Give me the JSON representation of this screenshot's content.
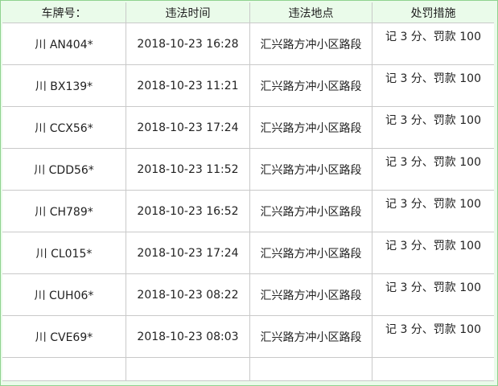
{
  "table": {
    "headers": {
      "plate": "车牌号：",
      "time": "违法时间",
      "location": "违法地点",
      "penalty": "处罚措施"
    },
    "rows": [
      {
        "plate": "川 AN404*",
        "time": "2018-10-23 16:28",
        "location": "汇兴路方冲小区路段",
        "penalty": "记 3 分、罚款 100"
      },
      {
        "plate": "川 BX139*",
        "time": "2018-10-23 11:21",
        "location": "汇兴路方冲小区路段",
        "penalty": "记 3 分、罚款 100"
      },
      {
        "plate": "川 CCX56*",
        "time": "2018-10-23 17:24",
        "location": "汇兴路方冲小区路段",
        "penalty": "记 3 分、罚款 100"
      },
      {
        "plate": "川 CDD56*",
        "time": "2018-10-23 11:52",
        "location": "汇兴路方冲小区路段",
        "penalty": "记 3 分、罚款 100"
      },
      {
        "plate": "川 CH789*",
        "time": "2018-10-23 16:52",
        "location": "汇兴路方冲小区路段",
        "penalty": "记 3 分、罚款 100"
      },
      {
        "plate": "川 CL015*",
        "time": "2018-10-23 17:24",
        "location": "汇兴路方冲小区路段",
        "penalty": "记 3 分、罚款 100"
      },
      {
        "plate": "川 CUH06*",
        "time": "2018-10-23 08:22",
        "location": "汇兴路方冲小区路段",
        "penalty": "记 3 分、罚款 100"
      },
      {
        "plate": "川 CVE69*",
        "time": "2018-10-23 08:03",
        "location": "汇兴路方冲小区路段",
        "penalty": "记 3 分、罚款 100"
      }
    ]
  },
  "colors": {
    "header_background": "#eafbea",
    "frame_border": "#8fd28f",
    "cell_border": "#c9c9c9"
  }
}
